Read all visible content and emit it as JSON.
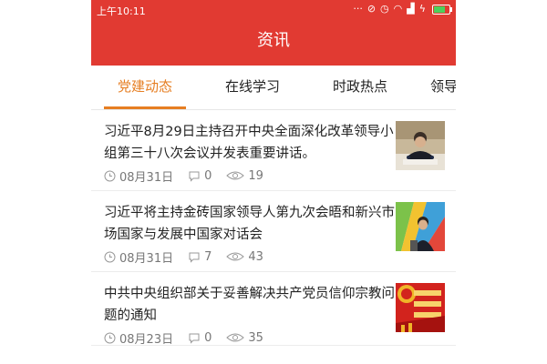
{
  "status_bar": {
    "time": "上午10:11"
  },
  "header": {
    "title": "资讯"
  },
  "tabs": [
    {
      "label": "党建动态",
      "active": true
    },
    {
      "label": "在线学习",
      "active": false
    },
    {
      "label": "时政热点",
      "active": false
    },
    {
      "label": "领导",
      "active": false
    }
  ],
  "articles": [
    {
      "title": "习近平8月29日主持召开中央全面深化改革领导小组第三十八次会议并发表重要讲话。",
      "date": "08月31日",
      "comments": "0",
      "views": "19",
      "thumb_icon": "photo-official-speech"
    },
    {
      "title": "习近平将主持金砖国家领导人第九次会晤和新兴市场国家与发展中国家对话会",
      "date": "08月31日",
      "comments": "7",
      "views": "43",
      "thumb_icon": "photo-leader-podium"
    },
    {
      "title": "中共中央组织部关于妥善解决共产党员信仰宗教问题的通知",
      "date": "08月23日",
      "comments": "0",
      "views": "35",
      "thumb_icon": "photo-party-banner"
    }
  ],
  "colors": {
    "brand_red": "#e13a32",
    "active_tab": "#e67e22"
  }
}
